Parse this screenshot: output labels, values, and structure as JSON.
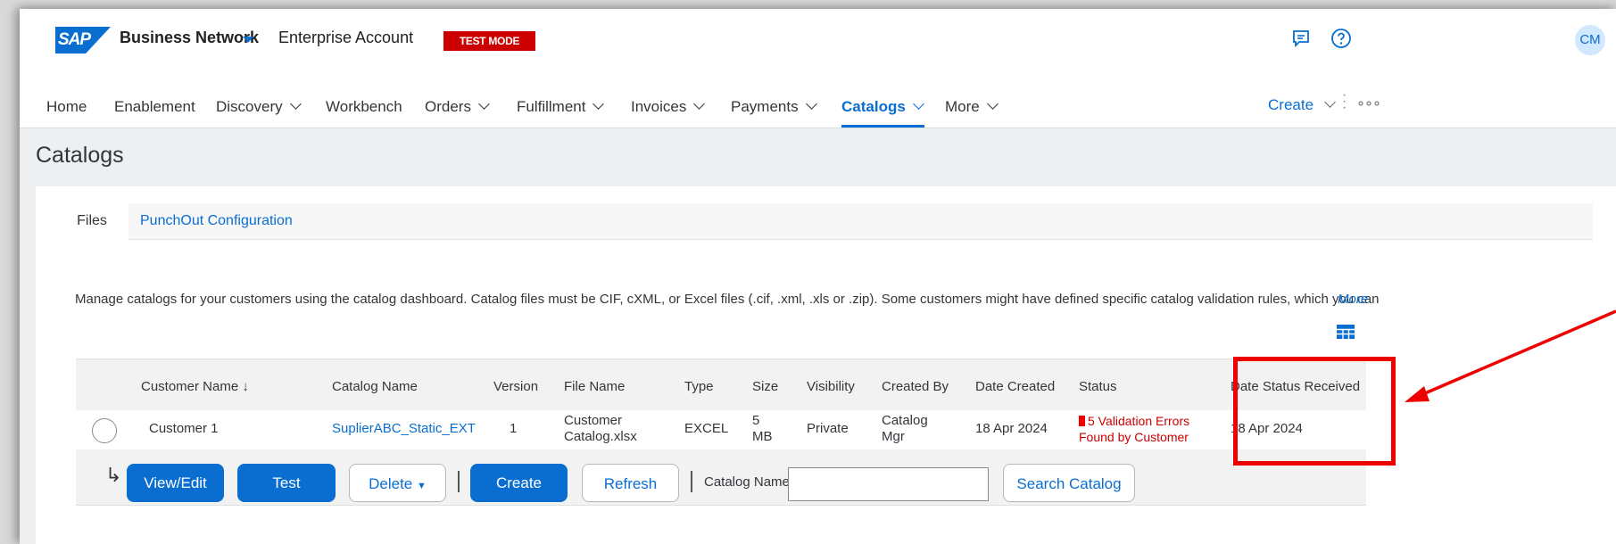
{
  "header": {
    "logo": "SAP",
    "brand": "Business Network",
    "account": "Enterprise Account",
    "test_mode": "TEST MODE",
    "icons": [
      "notifications-icon",
      "help-icon"
    ],
    "avatar_initials": "CM"
  },
  "nav": {
    "items": [
      {
        "label": "Home"
      },
      {
        "label": "Enablement"
      },
      {
        "label": "Discovery"
      },
      {
        "label": "Workbench"
      },
      {
        "label": "Orders"
      },
      {
        "label": "Fulfillment"
      },
      {
        "label": "Invoices"
      },
      {
        "label": "Payments"
      },
      {
        "label": "Catalogs"
      },
      {
        "label": "More"
      }
    ],
    "active": "Catalogs",
    "create": "Create"
  },
  "page": {
    "title": "Catalogs",
    "tabs": [
      {
        "label": "Files"
      },
      {
        "label": "PunchOut Configuration"
      }
    ],
    "description": "Manage catalogs for your customers using the catalog dashboard. Catalog files must be CIF, cXML, or Excel files (.cif, .xml, .xls or .zip). Some customers might have defined specific catalog validation rules, which you can",
    "more": "More"
  },
  "table": {
    "headers": [
      "Customer Name",
      "Catalog Name",
      "Version",
      "File Name",
      "Type",
      "Size",
      "Visibility",
      "Created By",
      "Date Created",
      "Status",
      "Date Status Received"
    ],
    "sort_indicator": "↓",
    "rows": [
      {
        "customer": "Customer 1",
        "catalog": "SuplierABC_Static_EXT",
        "version": "1",
        "file_line1": "Customer",
        "file_line2": "Catalog.xlsx",
        "type": "EXCEL",
        "size_line1": "5",
        "size_line2": "MB",
        "visibility": "Private",
        "created_by_line1": "Catalog",
        "created_by_line2": "Mgr",
        "date_created": "18 Apr 2024",
        "status_line1": "5 Validation Errors",
        "status_line2": "Found by Customer",
        "date_status": "18 Apr 2024"
      }
    ]
  },
  "actions": {
    "view_edit": "View/Edit",
    "test": "Test",
    "delete": "Delete",
    "create": "Create",
    "refresh": "Refresh",
    "catalog_name_label": "Catalog Name",
    "catalog_name_value": "",
    "search": "Search Catalog"
  },
  "colors": {
    "accent": "#0a6ed1",
    "test_mode": "#cc0000",
    "error": "#cc0000",
    "annotation": "#e00000"
  }
}
